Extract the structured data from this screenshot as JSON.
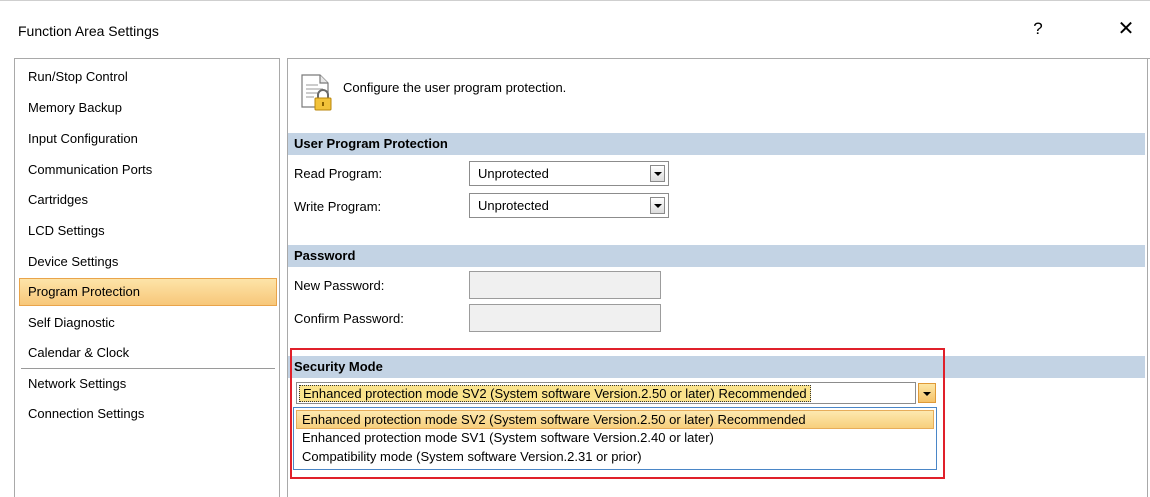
{
  "window": {
    "title": "Function Area Settings",
    "help_label": "?",
    "close_label": "✕"
  },
  "nav": {
    "items": [
      {
        "label": "Run/Stop Control"
      },
      {
        "label": "Memory Backup"
      },
      {
        "label": "Input Configuration"
      },
      {
        "label": "Communication Ports"
      },
      {
        "label": "Cartridges"
      },
      {
        "label": "LCD Settings"
      },
      {
        "label": "Device Settings"
      },
      {
        "label": "Program Protection",
        "selected": true
      },
      {
        "label": "Self Diagnostic"
      },
      {
        "label": "Calendar & Clock"
      },
      {
        "label": "Network Settings"
      },
      {
        "label": "Connection Settings"
      }
    ]
  },
  "page": {
    "icon": "document-lock-icon",
    "description": "Configure the user program protection."
  },
  "user_program_protection": {
    "header": "User Program Protection",
    "read_label": "Read Program:",
    "read_value": "Unprotected",
    "write_label": "Write Program:",
    "write_value": "Unprotected"
  },
  "password": {
    "header": "Password",
    "new_label": "New Password:",
    "new_value": "",
    "confirm_label": "Confirm Password:",
    "confirm_value": ""
  },
  "security_mode": {
    "header": "Security Mode",
    "selected": "Enhanced protection mode SV2 (System software Version.2.50 or later) Recommended",
    "options": [
      "Enhanced protection mode SV2 (System software Version.2.50 or later) Recommended",
      "Enhanced protection mode SV1 (System software Version.2.40 or later)",
      "Compatibility mode (System software Version.2.31 or prior)"
    ]
  },
  "colors": {
    "section_header": "#c3d3e4",
    "selection": "#f7c77a",
    "highlight_border": "#e0202a",
    "dropdown_border": "#4a86c7"
  }
}
